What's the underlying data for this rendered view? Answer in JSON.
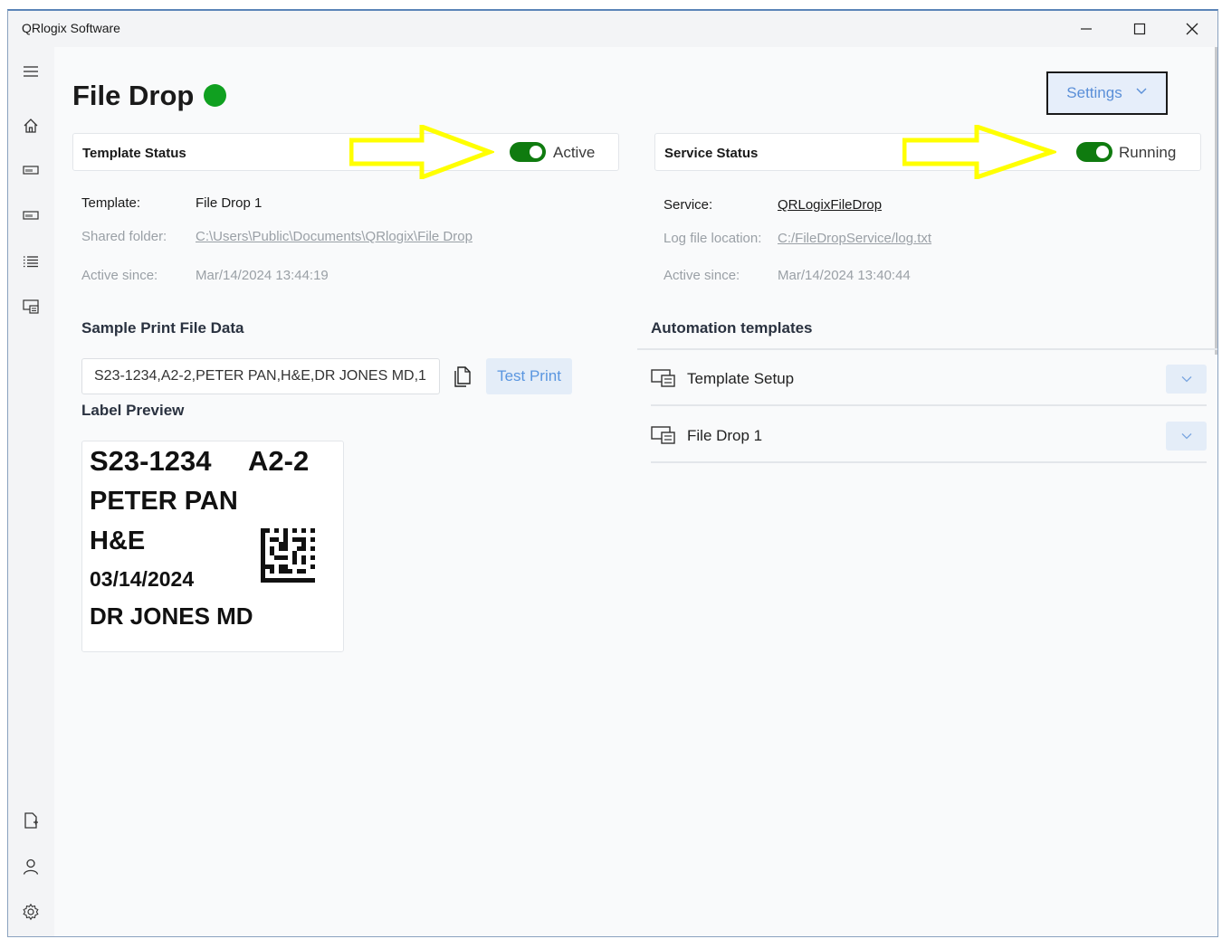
{
  "app": {
    "title": "QRlogix Software"
  },
  "page": {
    "title": "File Drop",
    "status_color": "#10a020"
  },
  "header": {
    "settings_label": "Settings"
  },
  "template_status": {
    "label": "Template Status",
    "toggle_label": "Active",
    "toggle_on": true,
    "template_key": "Template:",
    "template_value": "File Drop 1",
    "shared_folder_key": "Shared folder:",
    "shared_folder_value": "C:\\Users\\Public\\Documents\\QRlogix\\File Drop",
    "active_since_key": "Active since:",
    "active_since_value": "Mar/14/2024 13:44:19"
  },
  "service_status": {
    "label": "Service Status",
    "toggle_label": "Running",
    "toggle_on": true,
    "service_key": "Service:",
    "service_value": "QRLogixFileDrop",
    "log_key": "Log file location:",
    "log_value": "C:/FileDropService/log.txt",
    "active_since_key": "Active since:",
    "active_since_value": "Mar/14/2024 13:40:44"
  },
  "sample": {
    "title": "Sample Print File Data",
    "input_value": "S23-1234,A2-2,PETER PAN,H&E,DR JONES MD,1",
    "test_print_label": "Test Print"
  },
  "label_preview": {
    "title": "Label Preview",
    "case_number": "S23-1234",
    "block": "A2-2",
    "patient": "PETER PAN",
    "stain": "H&E",
    "date": "03/14/2024",
    "doctor": "DR JONES MD"
  },
  "automation": {
    "title": "Automation templates",
    "templates": [
      {
        "name": "Template Setup"
      },
      {
        "name": "File Drop 1"
      }
    ]
  },
  "colors": {
    "accent": "#5a8fd8",
    "toggle": "#0f7b0f",
    "annotation_arrow": "#ffff00"
  },
  "icons": {
    "nav": [
      "hamburger-icon",
      "home-icon",
      "printer-icon",
      "printer-icon",
      "list-icon",
      "template-icon"
    ],
    "nav_bottom": [
      "new-file-icon",
      "user-icon",
      "gear-icon"
    ]
  }
}
